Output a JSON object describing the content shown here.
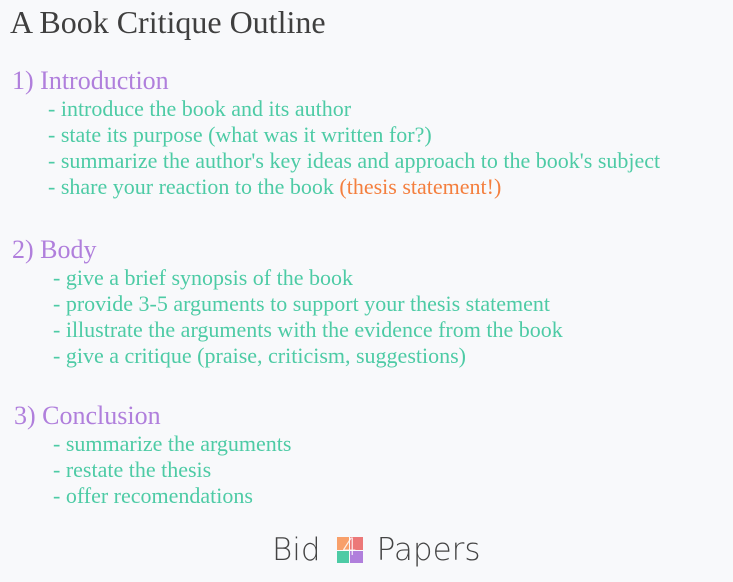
{
  "title": "A Book Critique Outline",
  "colors": {
    "title": "#3f3f3f",
    "heading": "#b07fdc",
    "item": "#4dcba5",
    "highlight": "#f47f3e",
    "logo_tiles": [
      "#f8a06a",
      "#ec7878",
      "#4dcba5",
      "#b07fdc"
    ]
  },
  "sections": [
    {
      "heading": "1) Introduction",
      "items": [
        "- introduce the book and its author",
        "- state its purpose (what was it written for?)",
        "- summarize the author's key ideas and approach to the book's subject",
        "- share your reaction to the book "
      ],
      "highlight": "(thesis statement!)"
    },
    {
      "heading": "2) Body",
      "items": [
        "- give a brief synopsis of the book",
        "- provide 3-5 arguments to support your thesis statement",
        "- illustrate the arguments with the evidence from the book",
        "- give a critique (praise, criticism, suggestions)"
      ]
    },
    {
      "heading": "3) Conclusion",
      "items": [
        "- summarize the arguments",
        "- restate the thesis",
        "- offer recomendations"
      ]
    }
  ],
  "logo": {
    "left": "Bid",
    "mark": "4",
    "right": "Papers"
  }
}
